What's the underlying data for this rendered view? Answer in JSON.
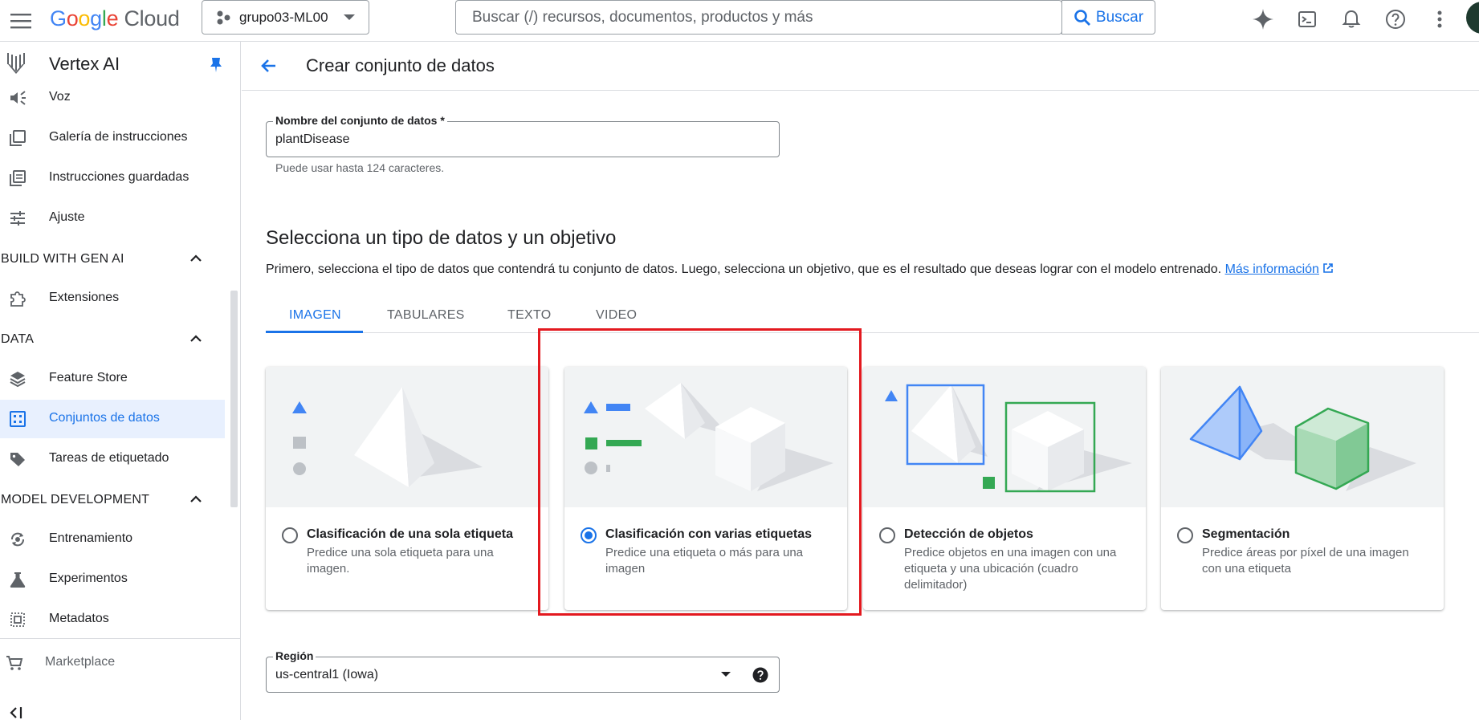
{
  "topbar": {
    "logo_google": "Google",
    "logo_cloud": "Cloud",
    "project_name": "grupo03-ML00",
    "search_placeholder": "Buscar (/) recursos, documentos, productos y más",
    "search_button": "Buscar",
    "icons": [
      "menu-icon",
      "gemini-icon",
      "cloud-shell-icon",
      "notifications-icon",
      "help-icon",
      "more-vert-icon"
    ]
  },
  "sidebar": {
    "title": "Vertex AI",
    "items_top": [
      {
        "label": "Voz",
        "icon": "voice-icon"
      },
      {
        "label": "Galería de instrucciones",
        "icon": "gallery-icon"
      },
      {
        "label": "Instrucciones guardadas",
        "icon": "saved-prompts-icon"
      },
      {
        "label": "Ajuste",
        "icon": "tune-icon"
      }
    ],
    "section_build": "BUILD WITH GEN AI",
    "extensions": "Extensiones",
    "section_data": "DATA",
    "feature_store": "Feature Store",
    "datasets": "Conjuntos de datos",
    "labeling": "Tareas de etiquetado",
    "section_model": "MODEL DEVELOPMENT",
    "training": "Entrenamiento",
    "experiments": "Experimentos",
    "metadata": "Metadatos",
    "marketplace": "Marketplace",
    "collapse_glyph": "<|"
  },
  "main": {
    "title": "Crear conjunto de datos",
    "name_field": {
      "label": "Nombre del conjunto de datos *",
      "value": "plantDisease",
      "hint": "Puede usar hasta 124 caracteres."
    },
    "section_title": "Selecciona un tipo de datos y un objetivo",
    "section_desc": "Primero, selecciona el tipo de datos que contendrá tu conjunto de datos. Luego, selecciona un objetivo, que es el resultado que deseas lograr con el modelo entrenado.",
    "more_info": "Más información",
    "tabs": [
      "IMAGEN",
      "TABULARES",
      "TEXTO",
      "VIDEO"
    ],
    "active_tab": "IMAGEN",
    "cards": [
      {
        "title": "Clasificación de una sola etiqueta",
        "desc": "Predice una sola etiqueta para una imagen.",
        "selected": false
      },
      {
        "title": "Clasificación con varias etiquetas",
        "desc": "Predice una etiqueta o más para una imagen",
        "selected": true
      },
      {
        "title": "Detección de objetos",
        "desc": "Predice objetos en una imagen con una etiqueta y una ubicación (cuadro delimitador)",
        "selected": false
      },
      {
        "title": "Segmentación",
        "desc": "Predice áreas por píxel de una imagen con una etiqueta",
        "selected": false
      }
    ],
    "region_field": {
      "label": "Región",
      "value": "us-central1 (Iowa)"
    }
  },
  "colors": {
    "accent": "#1a73e8",
    "highlight": "#e3191f",
    "active_bg": "#e8f0fe"
  }
}
